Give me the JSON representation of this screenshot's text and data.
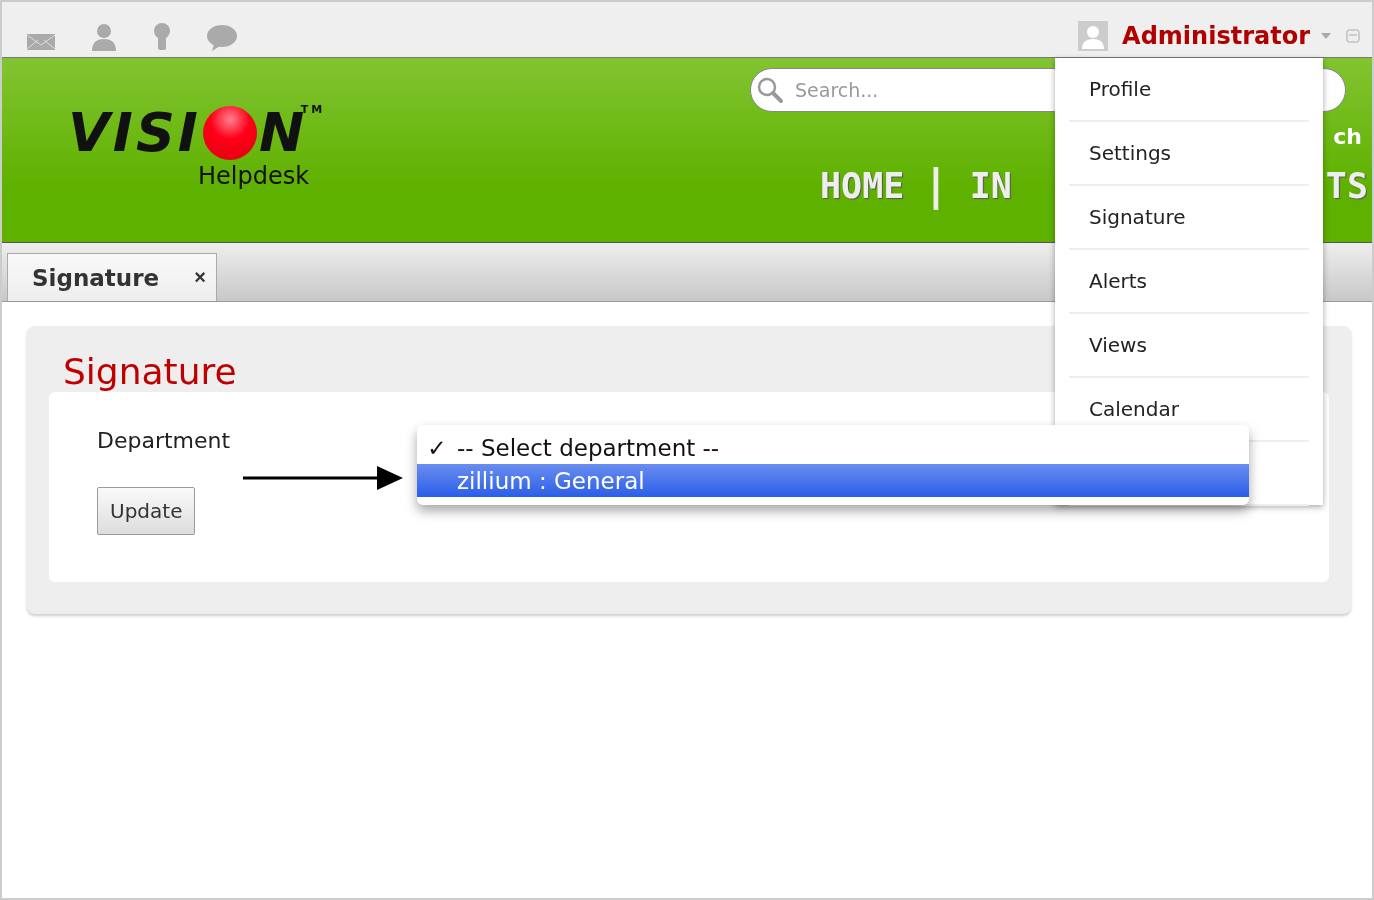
{
  "top_bar": {
    "user": "Administrator"
  },
  "logo": {
    "left": "VISI",
    "right": "N",
    "tm": "TM",
    "subtitle": "Helpdesk"
  },
  "search": {
    "placeholder": "Search...",
    "link": "ch"
  },
  "nav": {
    "items": [
      "HOME",
      "IN"
    ],
    "separator": "|",
    "tail": "TS"
  },
  "tabs": [
    {
      "label": "Signature",
      "close": "×",
      "selected": true
    }
  ],
  "panel": {
    "title": "Signature",
    "field_label": "Department",
    "button": "Update"
  },
  "department_select": {
    "check": "✓",
    "options": [
      {
        "label": "-- Select department --",
        "checked": true,
        "selected": false
      },
      {
        "label": "zillium : General",
        "checked": false,
        "selected": true
      }
    ]
  },
  "user_menu": {
    "items": [
      {
        "label": "Profile"
      },
      {
        "label": "Settings"
      },
      {
        "label": "Signature"
      },
      {
        "label": "Alerts"
      },
      {
        "label": "Views"
      },
      {
        "label": "Calendar"
      }
    ]
  }
}
